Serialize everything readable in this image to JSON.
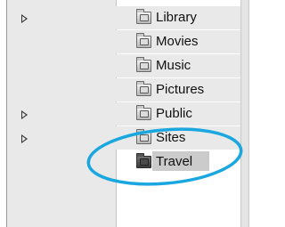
{
  "finder_column": {
    "items": [
      {
        "label": "Library",
        "has_children": true,
        "icon": "library-folder-icon",
        "selected": false
      },
      {
        "label": "Movies",
        "has_children": false,
        "icon": "movies-folder-icon",
        "selected": false
      },
      {
        "label": "Music",
        "has_children": false,
        "icon": "music-folder-icon",
        "selected": false
      },
      {
        "label": "Pictures",
        "has_children": false,
        "icon": "pictures-folder-icon",
        "selected": false
      },
      {
        "label": "Public",
        "has_children": true,
        "icon": "public-folder-icon",
        "selected": false
      },
      {
        "label": "Sites",
        "has_children": true,
        "icon": "sites-folder-icon",
        "selected": false
      },
      {
        "label": "Travel",
        "has_children": false,
        "icon": "travel-folder-icon",
        "selected": true
      }
    ]
  },
  "annotation": {
    "shape": "ellipse",
    "color": "#1aa7e0",
    "target": "Travel"
  },
  "colors": {
    "row_shade": "#e9e9e9",
    "selection": "#cbcbcb"
  }
}
